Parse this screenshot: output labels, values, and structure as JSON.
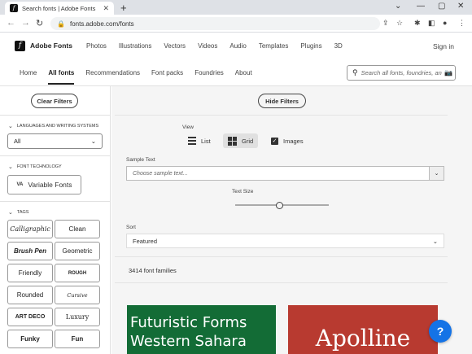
{
  "browser": {
    "tab_title": "Search fonts | Adobe Fonts",
    "url": "fonts.adobe.com/fonts"
  },
  "header": {
    "brand": "Adobe Fonts",
    "nav": [
      "Photos",
      "Illustrations",
      "Vectors",
      "Videos",
      "Audio",
      "Templates",
      "Plugins",
      "3D"
    ],
    "signin": "Sign in"
  },
  "subnav": {
    "items": [
      "Home",
      "All fonts",
      "Recommendations",
      "Font packs",
      "Foundries",
      "About"
    ],
    "active_index": 1,
    "search_placeholder": "Search all fonts, foundries, and"
  },
  "sidebar": {
    "clear_filters": "Clear Filters",
    "languages_header": "LANGUAGES AND WRITING SYSTEMS",
    "language_value": "All",
    "font_tech_header": "FONT TECHNOLOGY",
    "variable_fonts": "Variable Fonts",
    "variable_icon_text": "VA",
    "tags_header": "TAGS",
    "tags": [
      "Calligraphic",
      "Clean",
      "Brush Pen",
      "Geometric",
      "Friendly",
      "ROUGH",
      "Rounded",
      "Cursive",
      "ART DECO",
      "Luxury",
      "Funky",
      "Fun"
    ]
  },
  "main": {
    "hide_filters": "Hide Filters",
    "view_label": "View",
    "view_list": "List",
    "view_grid": "Grid",
    "images_label": "Images",
    "images_checked": true,
    "sample_text_label": "Sample Text",
    "sample_text_placeholder": "Choose sample text...",
    "text_size_label": "Text Size",
    "text_size_level": 0.48,
    "sort_label": "Sort",
    "sort_value": "Featured",
    "count": "3414 font families",
    "cards": [
      {
        "line1": "Futuristic Forms",
        "line2": "Western Sahara",
        "bg": "#136c36"
      },
      {
        "line1": "Apolline",
        "bg": "#b83a30"
      }
    ],
    "help": "?"
  },
  "colors": {
    "accent": "#1473e6",
    "card_green": "#136c36",
    "card_red": "#b83a30"
  }
}
